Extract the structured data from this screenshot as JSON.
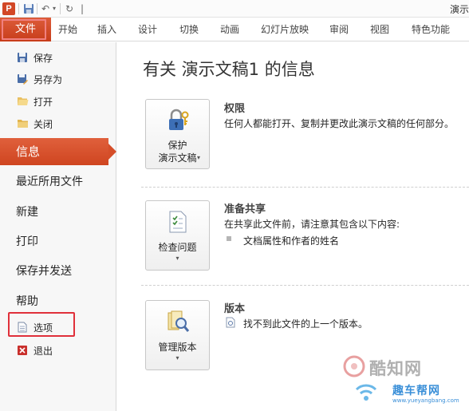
{
  "window": {
    "app_icon_letter": "P",
    "title": "演示"
  },
  "quick_access": {
    "save_icon": "save-icon",
    "undo_icon": "undo-icon",
    "undo_dropdown_icon": "chevron-down-icon",
    "redo_icon": "redo-icon"
  },
  "ribbon": {
    "file_tab": "文件",
    "tabs": [
      "开始",
      "插入",
      "设计",
      "切换",
      "动画",
      "幻灯片放映",
      "审阅",
      "视图",
      "特色功能"
    ]
  },
  "nav": {
    "save": "保存",
    "save_as": "另存为",
    "open": "打开",
    "close": "关闭",
    "info": "信息",
    "recent": "最近所用文件",
    "new": "新建",
    "print": "打印",
    "save_send": "保存并发送",
    "help": "帮助",
    "options": "选项",
    "exit": "退出"
  },
  "info": {
    "title": "有关 演示文稿1 的信息",
    "permissions": {
      "button_line1": "保护",
      "button_line2": "演示文稿",
      "heading": "权限",
      "description": "任何人都能打开、复制并更改此演示文稿的任何部分。"
    },
    "prepare": {
      "button": "检查问题",
      "heading": "准备共享",
      "description": "在共享此文件前，请注意其包含以下内容:",
      "bullet": "文档属性和作者的姓名"
    },
    "versions": {
      "button": "管理版本",
      "heading": "版本",
      "description": "找不到此文件的上一个版本。"
    }
  },
  "watermark": {
    "brand": "酷知网",
    "brand2": "趣车帮网",
    "url": "www.yueyangbang.com"
  },
  "colors": {
    "accent": "#d24726",
    "highlight_border": "#e0303a"
  }
}
